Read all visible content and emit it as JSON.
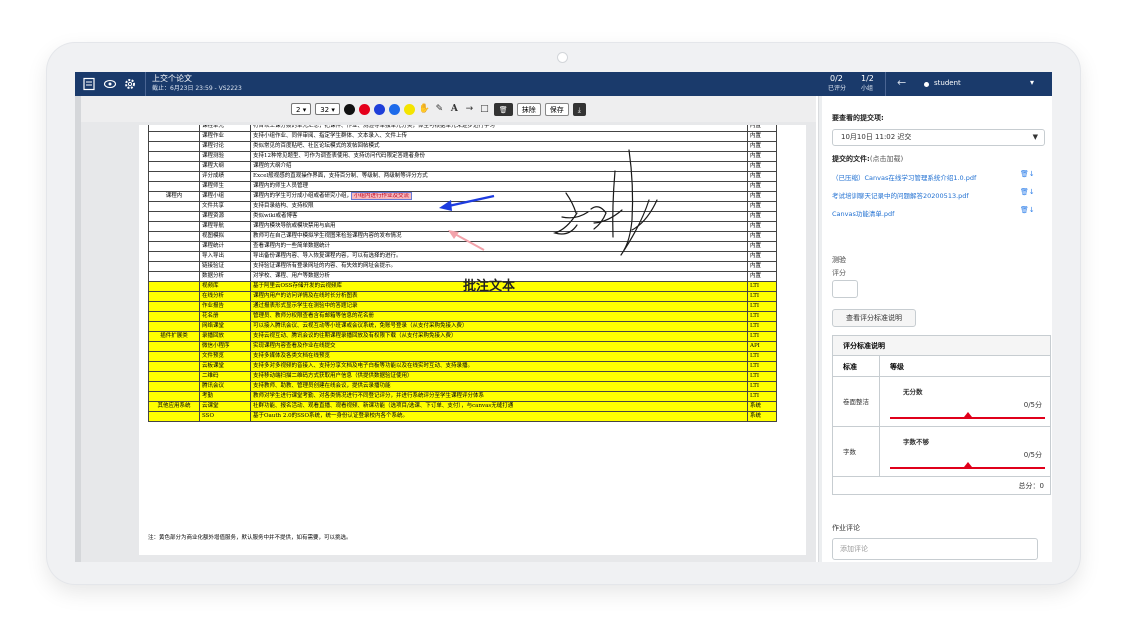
{
  "topbar": {
    "assignment_title": "上交个论文",
    "due": "截止：6月23日 23:59 - VS2223",
    "graded_count": "0/2",
    "graded_label": "已评分",
    "group_count": "1/2",
    "group_label": "小组",
    "student_label": "student"
  },
  "toolbar": {
    "stroke_value": "2",
    "size_value": "32",
    "colors": [
      "#111111",
      "#e5001b",
      "#1f3fd9",
      "#1e6bea",
      "#f4e400"
    ],
    "clear_label": "抹除",
    "save_label": "保存"
  },
  "document": {
    "rows": [
      {
        "group": "",
        "name": "课程单元",
        "desc": "符合以上课分拨的单元汇总，把课件、作业、测验等单独单元分类，体生可根据单元来逐步进行学习",
        "type": "内置"
      },
      {
        "group": "",
        "name": "课程作业",
        "desc": "支持小组作业、同伴审阅、指定学生群体、文本录入、文件上传",
        "type": "内置"
      },
      {
        "group": "",
        "name": "课程讨论",
        "desc": "类似常见的百度贴吧、社区论坛模式的发帖回帖模式",
        "type": "内置"
      },
      {
        "group": "",
        "name": "课程测验",
        "desc": "支持12种常见题型、可作为调查表使用、支持访问代码限定答题者身份",
        "type": "内置"
      },
      {
        "group": "",
        "name": "课程大纲",
        "desc": "课程的大纲介绍",
        "type": "内置"
      },
      {
        "group": "",
        "name": "评分成绩",
        "desc": "Excel般视感的直观操作界面，支持百分制、等级制、两级制等评分方式",
        "type": "内置"
      },
      {
        "group": "",
        "name": "课程师生",
        "desc": "课程内的师生人员管理",
        "type": "内置"
      },
      {
        "group": "课程内",
        "name": "课程小组",
        "desc": "课程内的学生可分成小组或者研究小组，",
        "type": "内置"
      },
      {
        "group": "",
        "name": "文件共享",
        "desc": "支持目录结构、支持权限",
        "type": "内置"
      },
      {
        "group": "",
        "name": "课程资源",
        "desc": "类似wiki或者博客",
        "type": "内置"
      },
      {
        "group": "",
        "name": "课程导航",
        "desc": "课程内模块导航或模块禁用与启用",
        "type": "内置"
      },
      {
        "group": "",
        "name": "视图模拟",
        "desc": "教师可在自己课程中模拟学生视图来检验课程内容的发布情况",
        "type": "内置"
      },
      {
        "group": "",
        "name": "课程统计",
        "desc": "查看课程内的一些简单数据统计",
        "type": "内置"
      },
      {
        "group": "",
        "name": "导入导出",
        "desc": "导出备份课程内容、导入恢复课程内容，可以有选择的进行。",
        "type": "内置"
      },
      {
        "group": "",
        "name": "链接验证",
        "desc": "支持验证课程所有登录网址的内容、有失效的网址会提示。",
        "type": "内置"
      },
      {
        "group": "",
        "name": "数据分析",
        "desc": "对学校、课程、用户等数据分析",
        "type": "内置"
      },
      {
        "group": "",
        "name": "视频库",
        "desc": "基于阿里云OSS存储开发的云视频库",
        "type": "LTI"
      },
      {
        "group": "",
        "name": "在线分析",
        "desc": "课程内用户的访问详情及在线时长分析图表",
        "type": "LTI"
      },
      {
        "group": "",
        "name": "作业报告",
        "desc": "通过报表形式显示学生在测验中的答题记录",
        "type": "LTI"
      },
      {
        "group": "",
        "name": "花名册",
        "desc": "管理员、教师分权限查看含有邮箱等信息的花名册",
        "type": "LTI"
      },
      {
        "group": "",
        "name": "网络课堂",
        "desc": "可以接入腾讯会议、云视互动等小班课或会议系统，免账号登录（从支付采购免接入费）",
        "type": "LTI"
      },
      {
        "group": "插件扩展类",
        "name": "录播回放",
        "desc": "支持云视互动、腾讯会议的往期课程录播回放及有权限下载（从支付采购免接入费）",
        "type": "LTI"
      },
      {
        "group": "",
        "name": "微信小程序",
        "desc": "实现课程内容查看及作业在线提交",
        "type": "API"
      },
      {
        "group": "",
        "name": "文件预览",
        "desc": "支持多媒体及各类文档在线预览",
        "type": "LTI"
      },
      {
        "group": "",
        "name": "云板课堂",
        "desc": "支持多对多视频的音接入、支持分享文档及电子白板等功能以及在线实时互动、支持录播。",
        "type": "LTI"
      },
      {
        "group": "",
        "name": "二维码",
        "desc": "支持移动端扫描二维码方式获取用户信息（供提供数据验证使用）",
        "type": "LTI"
      },
      {
        "group": "",
        "name": "腾讯会议",
        "desc": "支持教师、助教、管理员创建在线会议，提供云录播功能",
        "type": "LTI"
      },
      {
        "group": "",
        "name": "考勤",
        "desc": "教师对学生进行课堂考勤、对各类情况进行不同登记评分，并进行系统评分至学生课程评分体系",
        "type": "LTI"
      },
      {
        "group": "其他应用系统",
        "name": "云课堂",
        "desc": "社群功能、报名活动、观看直播、观看视频、新课功能（选项目/选课、下订单、支付），与canvas无缝打通",
        "type": "系统"
      },
      {
        "group": "",
        "name": "SSO",
        "desc": "基于Oauth 2.0的SSO系统，统一身份认证登录校内各个系统。",
        "type": "系统"
      }
    ],
    "highlight_text": "小组内进行作业及交流",
    "annotation_text": "批注文本",
    "note": "注：黄色部分为商业化额外增值服务，默认服务中并不提供，如有需要，可以挑选。"
  },
  "sidebar": {
    "submission_heading": "要查看的提交项:",
    "submission_value": "10月10日 11:02 迟交",
    "files_heading": "提交的文件:",
    "files_hint": "(点击加载)",
    "files": [
      "（已压缩）Canvas在线学习管理系统介绍1.0.pdf",
      "考试培训聊天记录中的问题解答20200513.pdf",
      "Canvas功能清单.pdf"
    ],
    "quiz_heading": "测验",
    "grade_label": "评分",
    "rubric_button": "查看评分标准说明",
    "rubric": {
      "title": "评分标准说明",
      "col_criteria": "标准",
      "col_rating": "等级",
      "rows": [
        {
          "criterion": "卷面整洁",
          "rating": "无分数",
          "points": "0/5分",
          "score_fraction": 0.5
        },
        {
          "criterion": "字数",
          "rating": "字数不够",
          "points": "0/5分",
          "score_fraction": 0.5
        }
      ],
      "total": "总分：0"
    },
    "comment_heading": "作业评论",
    "comment_placeholder": "添加评论"
  }
}
